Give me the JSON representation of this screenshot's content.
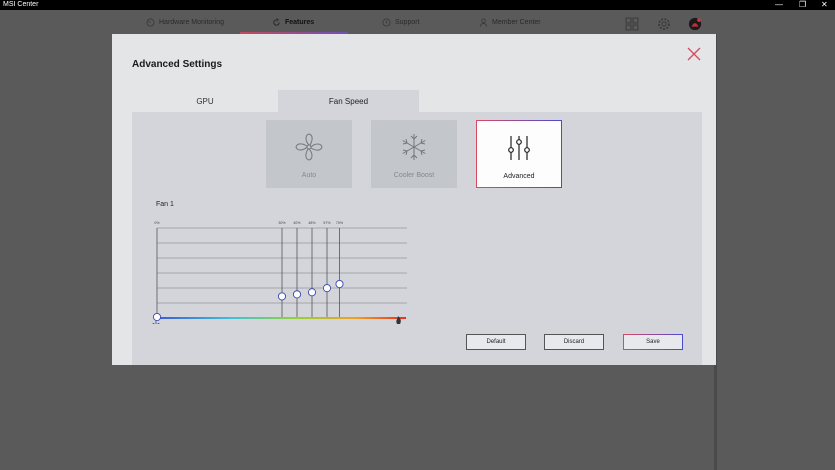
{
  "window": {
    "title": "MSI Center"
  },
  "nav": {
    "items": [
      {
        "label": "Hardware Monitoring"
      },
      {
        "label": "Features"
      },
      {
        "label": "Support"
      },
      {
        "label": "Member Center"
      }
    ]
  },
  "modal": {
    "title": "Advanced Settings",
    "tabs": [
      {
        "label": "GPU"
      },
      {
        "label": "Fan Speed"
      }
    ],
    "modes": [
      {
        "label": "Auto"
      },
      {
        "label": "Cooler Boost"
      },
      {
        "label": "Advanced"
      }
    ],
    "fan_label": "Fan 1",
    "buttons": {
      "default": "Default",
      "discard": "Discard",
      "save": "Save"
    }
  },
  "chart_data": {
    "type": "line",
    "point_labels": [
      "0%",
      "30%",
      "40%",
      "48%",
      "57%",
      "70%"
    ],
    "points": [
      {
        "x": 0,
        "y": 0
      },
      {
        "x": 50,
        "y": 20
      },
      {
        "x": 56,
        "y": 22
      },
      {
        "x": 62,
        "y": 24
      },
      {
        "x": 68,
        "y": 28
      },
      {
        "x": 73,
        "y": 32
      }
    ],
    "xlim": [
      0,
      100
    ],
    "ylim": [
      0,
      100
    ]
  },
  "colors": {
    "accent_red": "#d94a62",
    "accent_blue": "#4a4ad0"
  }
}
